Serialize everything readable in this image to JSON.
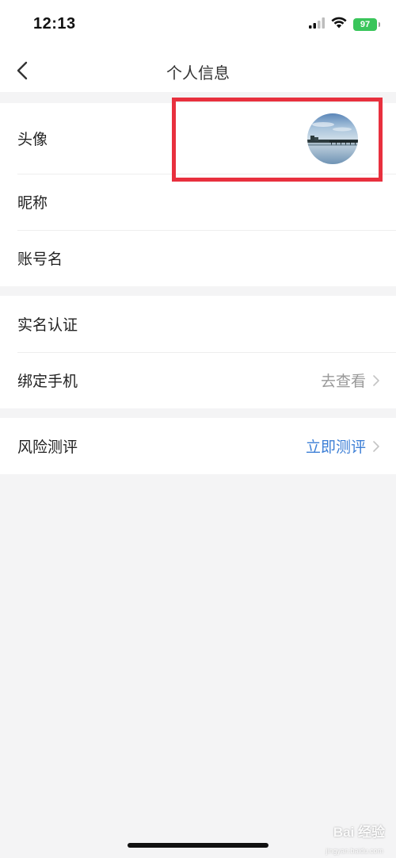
{
  "status_bar": {
    "time": "12:13",
    "battery": "97",
    "icons": [
      "cellular-signal-icon",
      "wifi-icon",
      "battery-icon"
    ]
  },
  "nav": {
    "title": "个人信息",
    "back_icon": "chevron-left-icon"
  },
  "groups": [
    {
      "rows": [
        {
          "label": "头像",
          "value": "",
          "has_avatar": true
        },
        {
          "label": "昵称",
          "value": ""
        },
        {
          "label": "账号名",
          "value": ""
        }
      ]
    },
    {
      "rows": [
        {
          "label": "实名认证",
          "value": ""
        },
        {
          "label": "绑定手机",
          "value": "去查看",
          "value_color": "#999999",
          "chevron": true
        }
      ]
    },
    {
      "rows": [
        {
          "label": "风险测评",
          "value": "立即测评",
          "value_color": "#3d7fd6",
          "chevron": true
        }
      ]
    }
  ],
  "annotation": {
    "highlight_color": "#e8303e",
    "target": "avatar"
  },
  "watermark": {
    "text": "Bai 经验",
    "sub": "jingyan.baidu.com"
  },
  "colors": {
    "background": "#f4f4f5",
    "card": "#ffffff",
    "accent_blue": "#3d7fd6",
    "battery_green": "#3ac55b"
  }
}
